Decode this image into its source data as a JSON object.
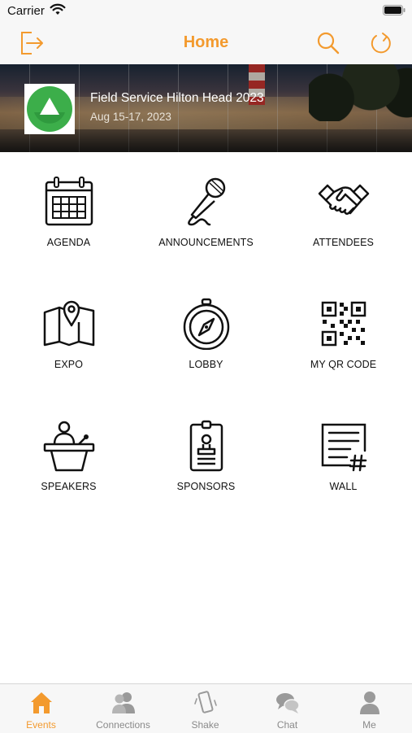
{
  "status_bar": {
    "carrier": "Carrier"
  },
  "nav": {
    "title": "Home"
  },
  "event": {
    "title": "Field Service Hilton Head 2023",
    "dates": "Aug 15-17, 2023"
  },
  "tiles": [
    {
      "label": "AGENDA",
      "icon": "calendar-icon"
    },
    {
      "label": "ANNOUNCEMENTS",
      "icon": "microphone-icon"
    },
    {
      "label": "ATTENDEES",
      "icon": "handshake-icon"
    },
    {
      "label": "EXPO",
      "icon": "map-pin-icon"
    },
    {
      "label": "LOBBY",
      "icon": "compass-icon"
    },
    {
      "label": "MY QR CODE",
      "icon": "qr-code-icon"
    },
    {
      "label": "SPEAKERS",
      "icon": "podium-icon"
    },
    {
      "label": "SPONSORS",
      "icon": "badge-icon"
    },
    {
      "label": "WALL",
      "icon": "wall-post-icon"
    }
  ],
  "tabs": [
    {
      "label": "Events",
      "icon": "house-icon",
      "active": true
    },
    {
      "label": "Connections",
      "icon": "people-icon"
    },
    {
      "label": "Shake",
      "icon": "phone-shake-icon"
    },
    {
      "label": "Chat",
      "icon": "chat-bubbles-icon"
    },
    {
      "label": "Me",
      "icon": "person-icon"
    }
  ],
  "colors": {
    "accent": "#f39a2e",
    "inactive": "#8a8a8a",
    "logo_green": "#3cae4a"
  }
}
